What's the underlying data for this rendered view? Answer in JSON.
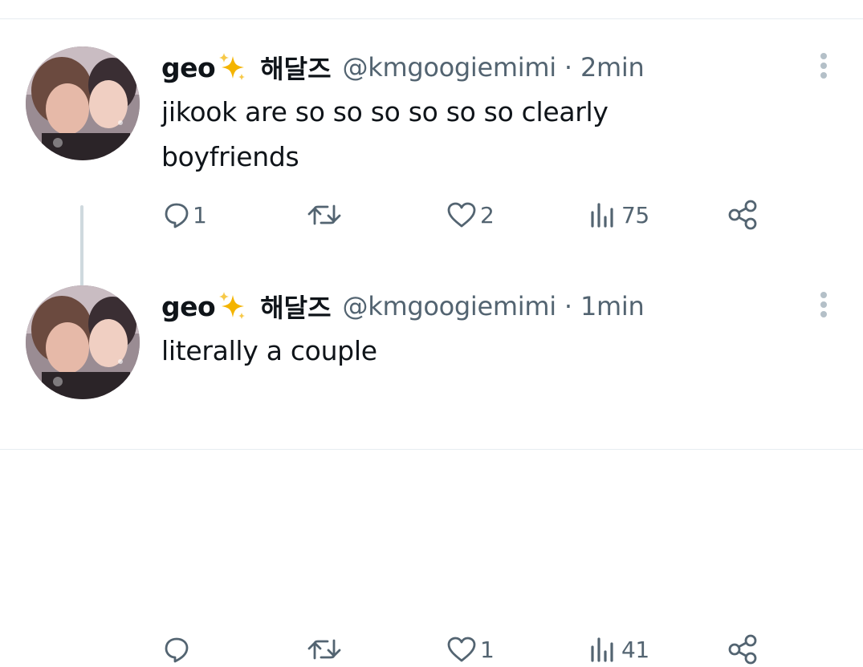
{
  "tweets": [
    {
      "name": "geo",
      "korean_name": "해달즈",
      "handle": "@kmgoogiemimi",
      "separator": "·",
      "time": "2min",
      "text": "jikook are so so so so so so clearly boyfriends",
      "replies": "1",
      "retweets": "",
      "likes": "2",
      "views": "75"
    },
    {
      "name": "geo",
      "korean_name": "해달즈",
      "handle": "@kmgoogiemimi",
      "separator": "·",
      "time": "1min",
      "text": "literally a couple",
      "replies": "",
      "retweets": "",
      "likes": "1",
      "views": "41"
    }
  ],
  "icons": {
    "name_emoji": "sparkles-icon",
    "reply": "reply-icon",
    "retweet": "retweet-icon",
    "like": "heart-icon",
    "views": "views-icon",
    "share": "share-icon",
    "more": "more-icon"
  },
  "colors": {
    "secondary_text": "#536471",
    "sparkle": "#f4b400",
    "divider": "#e6ecf0"
  }
}
